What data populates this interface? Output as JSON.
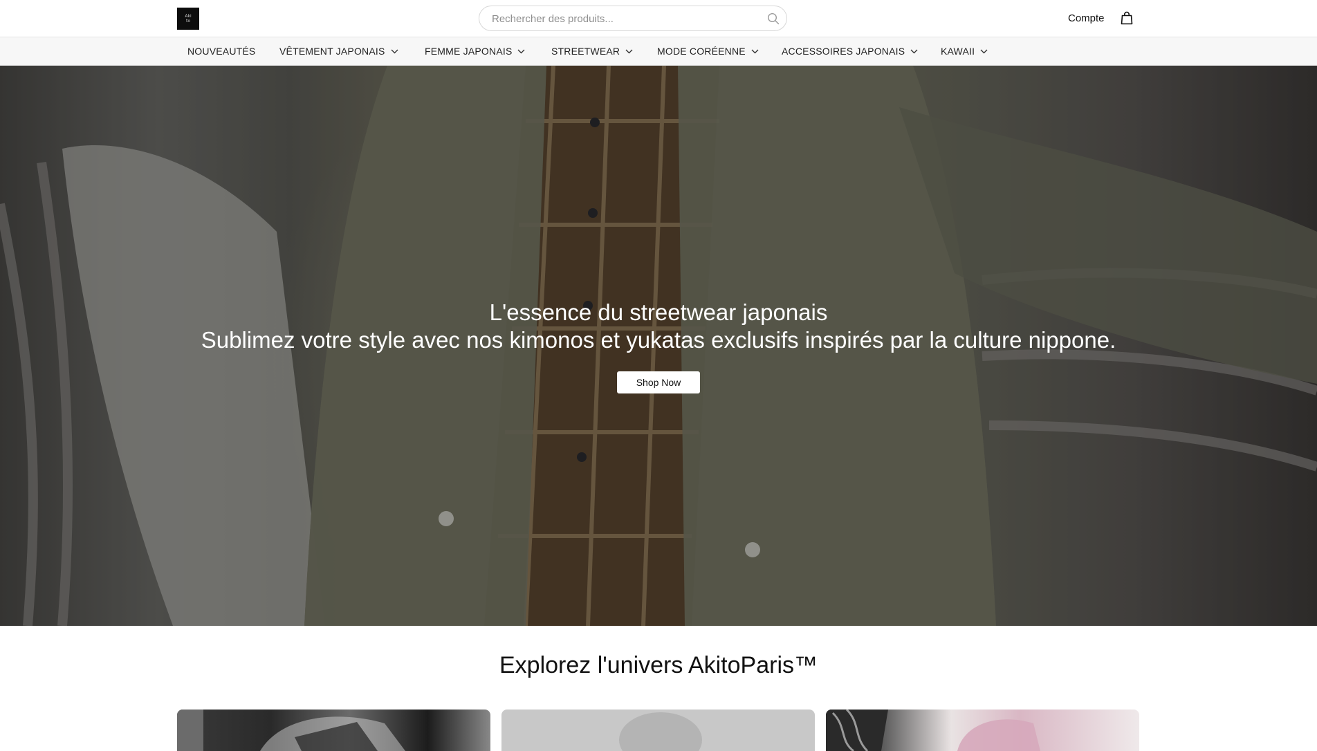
{
  "header": {
    "logo_icon": "brand-logo-icon",
    "logo_lines": [
      "Aki",
      "to"
    ],
    "search": {
      "placeholder": "Rechercher des produits...",
      "value": "",
      "icon": "search-icon"
    },
    "account_label": "Compte",
    "cart_icon": "shopping-bag-icon"
  },
  "nav": {
    "items": [
      {
        "label": "NOUVEAUTÉS",
        "has_dropdown": false
      },
      {
        "label": "VÊTEMENT JAPONAIS",
        "has_dropdown": true
      },
      {
        "label": "FEMME JAPONAIS",
        "has_dropdown": true
      },
      {
        "label": "STREETWEAR",
        "has_dropdown": true
      },
      {
        "label": "MODE CORÉENNE",
        "has_dropdown": true
      },
      {
        "label": "ACCESSOIRES JAPONAIS",
        "has_dropdown": true
      },
      {
        "label": "KAWAII",
        "has_dropdown": true
      }
    ]
  },
  "hero": {
    "title": "L'essence du streetwear japonais",
    "subtitle": "Sublimez votre style avec nos kimonos et yukatas exclusifs inspirés par la culture nippone.",
    "button_label": "Shop Now"
  },
  "explore": {
    "title": "Explorez l'univers AkitoParis™",
    "cards": [
      {
        "name": "collection-card-1"
      },
      {
        "name": "collection-card-2"
      },
      {
        "name": "collection-card-3"
      }
    ]
  },
  "colors": {
    "header_bg": "#ffffff",
    "nav_bg": "#f7f7f7",
    "text": "#111111",
    "button_bg": "#ffffff"
  }
}
